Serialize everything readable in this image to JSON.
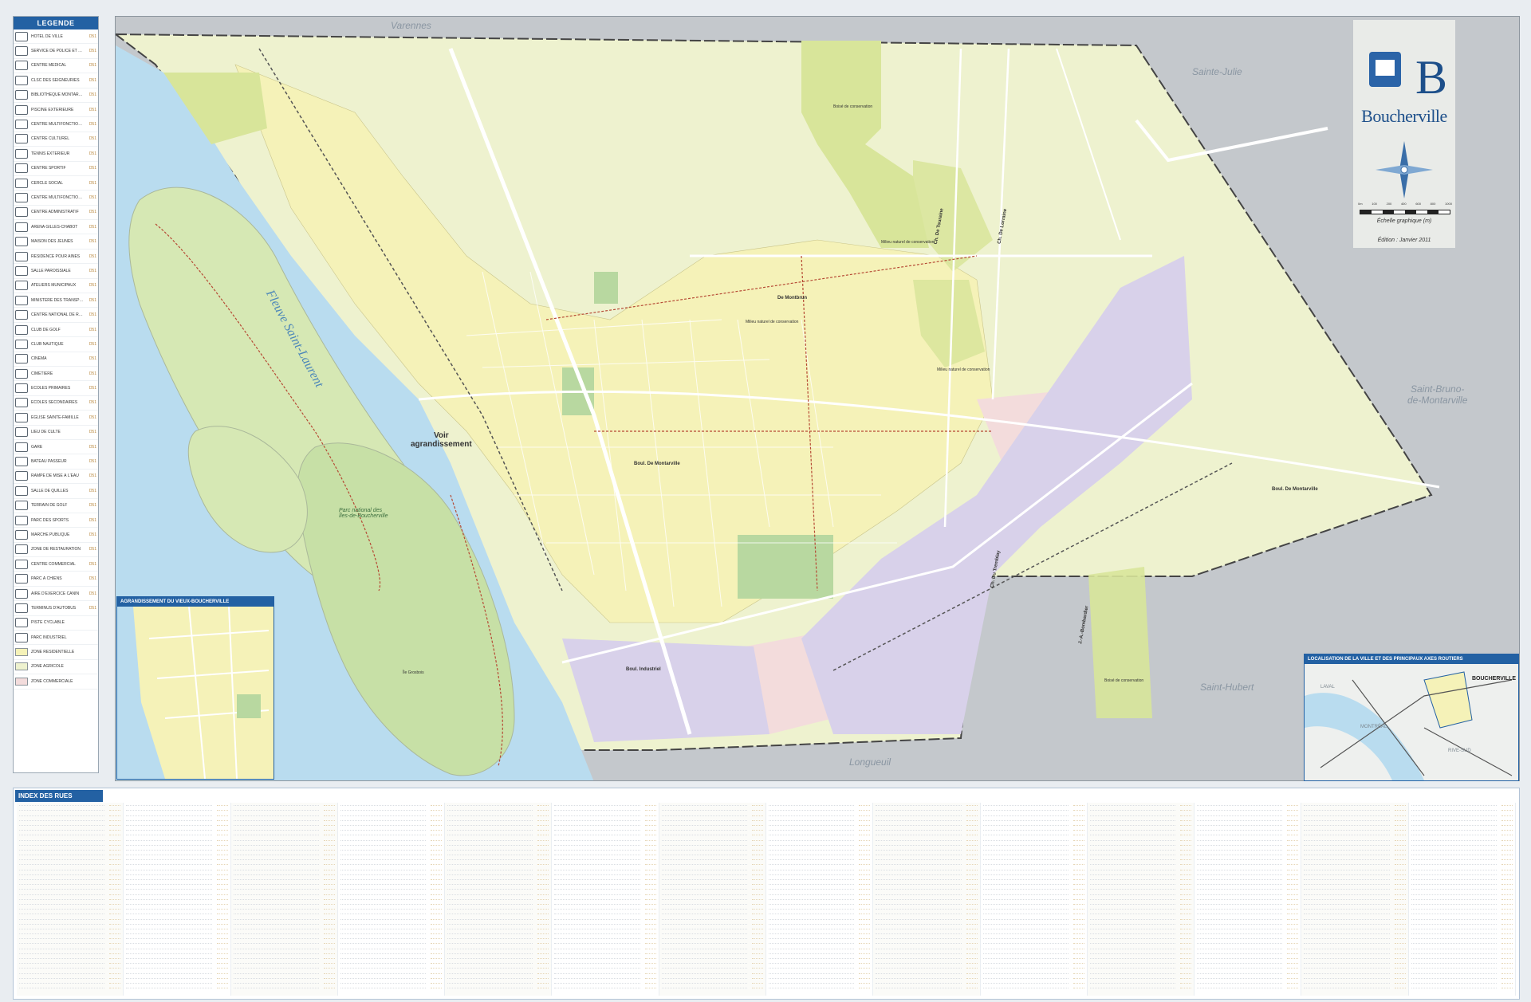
{
  "legend": {
    "title": "LEGENDE",
    "items": [
      {
        "label": "Hôtel de ville",
        "code": "D51",
        "icon": "city-hall-icon"
      },
      {
        "label": "Service de police et d'incendie",
        "code": "D51",
        "icon": "police-icon"
      },
      {
        "label": "Centre médical",
        "code": "D51",
        "icon": "medical-icon"
      },
      {
        "label": "CLSC des Seigneuries",
        "code": "D51",
        "icon": "clsc-icon"
      },
      {
        "label": "Bibliothèque Montarville-Boucher-de-La Bruère",
        "code": "D51",
        "icon": "library-icon"
      },
      {
        "label": "Piscine extérieure",
        "code": "D51",
        "icon": "pool-icon"
      },
      {
        "label": "Centre multifonctionnel",
        "code": "D51",
        "icon": "multi-icon"
      },
      {
        "label": "Centre culturel",
        "code": "D51",
        "icon": "culture-icon"
      },
      {
        "label": "Tennis extérieur",
        "code": "D51",
        "icon": "tennis-icon"
      },
      {
        "label": "Centre sportif",
        "code": "D51",
        "icon": "sport-icon"
      },
      {
        "label": "Cercle social",
        "code": "D51",
        "icon": "social-icon"
      },
      {
        "label": "Centre multifonctionnel",
        "code": "D51",
        "icon": "cmf-icon"
      },
      {
        "label": "Centre administratif",
        "code": "D51",
        "icon": "admin-icon"
      },
      {
        "label": "Aréna Gilles-Chabot",
        "code": "D51",
        "icon": "arena-icon"
      },
      {
        "label": "Maison des jeunes",
        "code": "D51",
        "icon": "youth-icon"
      },
      {
        "label": "Résidence pour aînés",
        "code": "D51",
        "icon": "senior-icon"
      },
      {
        "label": "Salle paroissiale",
        "code": "D51",
        "icon": "hall-icon"
      },
      {
        "label": "Ateliers municipaux",
        "code": "D51",
        "icon": "workshop-icon"
      },
      {
        "label": "Ministère des transports",
        "code": "D51",
        "icon": "mtq-icon"
      },
      {
        "label": "Centre national de recherches du Canada",
        "code": "D51",
        "icon": "cnrc-icon"
      },
      {
        "label": "Club de golf",
        "code": "D51",
        "icon": "golf-club-icon"
      },
      {
        "label": "Club nautique",
        "code": "D51",
        "icon": "nautical-icon"
      },
      {
        "label": "Cinéma",
        "code": "D51",
        "icon": "cinema-icon"
      },
      {
        "label": "Cimetière",
        "code": "D51",
        "icon": "cemetery-icon"
      },
      {
        "label": "Écoles primaires",
        "code": "D51",
        "icon": "school-icon"
      },
      {
        "label": "Écoles secondaires",
        "code": "D51",
        "icon": "high-school-icon"
      },
      {
        "label": "Église Sainte-Famille",
        "code": "D51",
        "icon": "church-icon"
      },
      {
        "label": "Lieu de culte",
        "code": "D51",
        "icon": "worship-icon"
      },
      {
        "label": "Gare",
        "code": "D51",
        "icon": "station-icon"
      },
      {
        "label": "Bateau passeur",
        "code": "D51",
        "icon": "ferry-icon"
      },
      {
        "label": "Rampe de mise à l'eau",
        "code": "D51",
        "icon": "boat-ramp-icon"
      },
      {
        "label": "Salle de quilles",
        "code": "D51",
        "icon": "bowling-icon"
      },
      {
        "label": "Terrain de golf",
        "code": "D51",
        "icon": "golf-icon"
      },
      {
        "label": "Parc des sports",
        "code": "D51",
        "icon": "park-icon"
      },
      {
        "label": "Marche publique",
        "code": "D51",
        "icon": "market-icon"
      },
      {
        "label": "Zone de restauration",
        "code": "D51",
        "icon": "restaurant-icon"
      },
      {
        "label": "Centre commercial",
        "code": "D51",
        "icon": "mall-icon"
      },
      {
        "label": "Parc à chiens",
        "code": "D51",
        "icon": "dog-park-icon"
      },
      {
        "label": "Aire d'exercice canin",
        "code": "D51",
        "icon": "dog-icon"
      },
      {
        "label": "Terminus d'autobus",
        "code": "D51",
        "icon": "bus-icon"
      },
      {
        "label": "Piste cyclable",
        "code": "",
        "icon": "bike-path-icon"
      },
      {
        "label": "Parc industriel",
        "code": "",
        "icon": "industrial-icon"
      },
      {
        "label": "Zone résidentielle",
        "code": "",
        "icon": "swatch-residential"
      },
      {
        "label": "Zone agricole",
        "code": "",
        "icon": "swatch-agricultural"
      },
      {
        "label": "Zone commerciale",
        "code": "",
        "icon": "swatch-commercial"
      }
    ]
  },
  "colors": {
    "water": "#b9dcef",
    "agricultural": "#eef2cf",
    "residential": "#f5f2b8",
    "conservation": "#d8e59a",
    "industrial": "#d8d1ea",
    "commercial": "#f3dcdc",
    "park": "#b8d8a0",
    "outside": "#c4c8cc",
    "accent": "#2361a3"
  },
  "map": {
    "places": {
      "varennes": "Varennes",
      "sainte_julie": "Sainte-Julie",
      "saint_bruno": "Saint-Bruno-\nde-Montarville",
      "saint_hubert": "Saint-Hubert",
      "longueuil": "Longueuil",
      "river": "Fleuve Saint-Laurent"
    },
    "voir": "Voir\nagrandissement",
    "labels": {
      "boisee1": "Boisé de conservation",
      "boisee2": "Boisé de conservation",
      "milieu1": "Milieu naturel de conservation",
      "milieu2": "Milieu naturel de conservation",
      "milieu3": "Milieu naturel de conservation",
      "montbrun": "De Montbrun",
      "montarville": "Boul. De Montarville",
      "montarville2": "Boul. De Montarville",
      "industriel": "Boul. Industriel",
      "parc_iles": "Parc national des\nÎles-de-Boucherville",
      "touraine": "Ch. De Touraine",
      "lorraine": "Ch. De Lorraine",
      "du_tremblay": "Ch. Du Tremblay",
      "ja_bombardier": "J.-A.-Bombardier",
      "grande_ile": "Île Grosbois"
    }
  },
  "logo": {
    "brand": "Boucherville",
    "scale_ticks": [
      "0m",
      "100",
      "200",
      "400",
      "600",
      "800",
      "1000"
    ],
    "scale_title": "Échelle graphique (m)",
    "edition": "Édition : Janvier 2011"
  },
  "insets": {
    "vieux_title": "AGRANDISSEMENT DU VIEUX-BOUCHERVILLE",
    "loc_title": "LOCALISATION DE LA VILLE ET DES PRINCIPAUX AXES ROUTIERS",
    "loc_labels": {
      "boucherville": "BOUCHERVILLE",
      "laval": "LAVAL",
      "montreal": "MONTRÉAL",
      "rive_sud": "RIVE-SUD"
    }
  },
  "index": {
    "title": "INDEX DES RUES"
  }
}
